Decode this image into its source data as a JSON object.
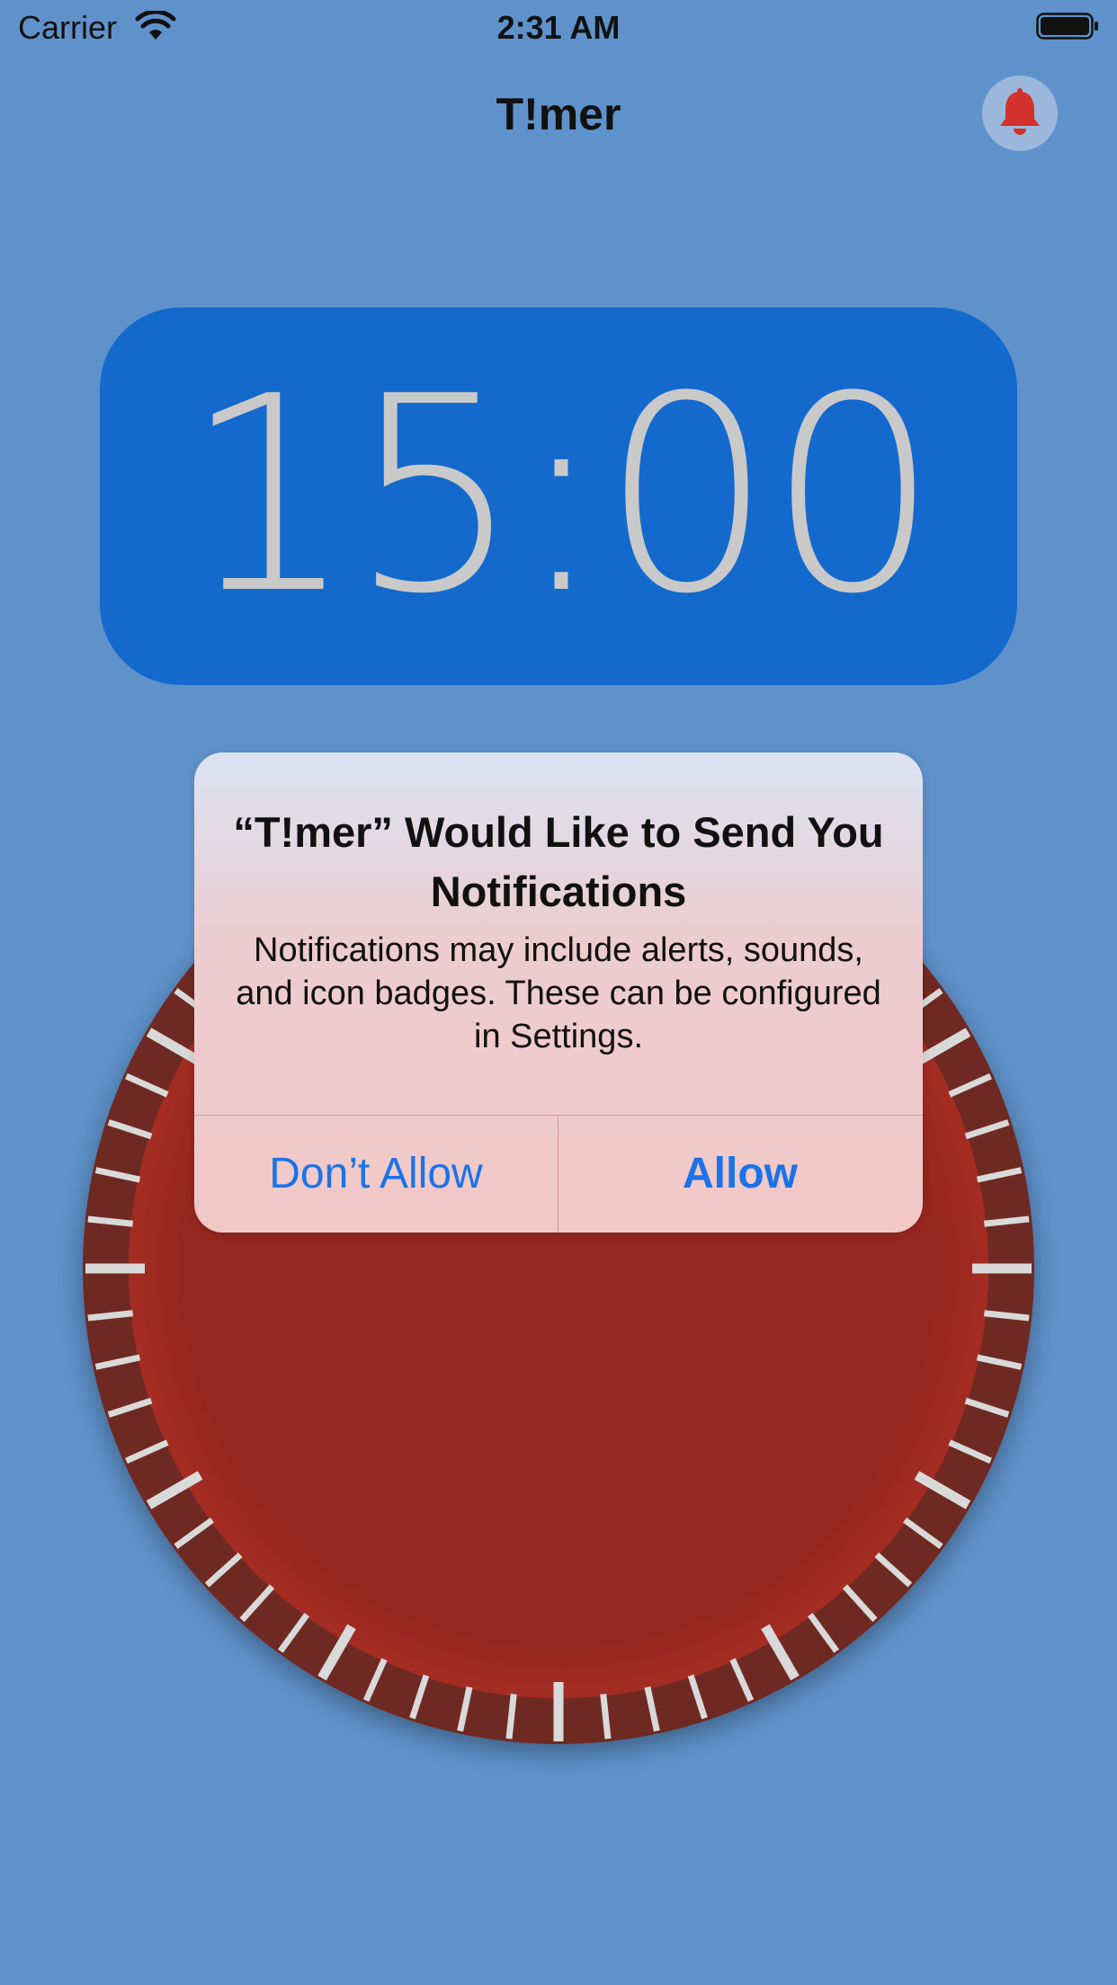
{
  "status_bar": {
    "carrier": "Carrier",
    "time": "2:31 AM",
    "wifi_icon": "wifi-icon",
    "battery_icon": "battery-icon"
  },
  "nav": {
    "title": "T!mer",
    "bell_icon": "bell-icon"
  },
  "timer": {
    "display": "15:00"
  },
  "dial": {
    "tick_count": 60,
    "major_every": 5
  },
  "alert": {
    "title": "“T!mer” Would Like to Send You Notifications",
    "message": "Notifications may include alerts, sounds, and icon badges. These can be configured in Settings.",
    "deny_label": "Don’t Allow",
    "allow_label": "Allow"
  },
  "colors": {
    "background": "#5f92cb",
    "timer_panel": "#1469cd",
    "timer_text": "#c9c9c9",
    "dial_face": "#962720",
    "dial_rim": "#6e2a23",
    "tick": "#d9d9d9",
    "alert_button": "#1a73e8",
    "bell": "#d3312b"
  }
}
